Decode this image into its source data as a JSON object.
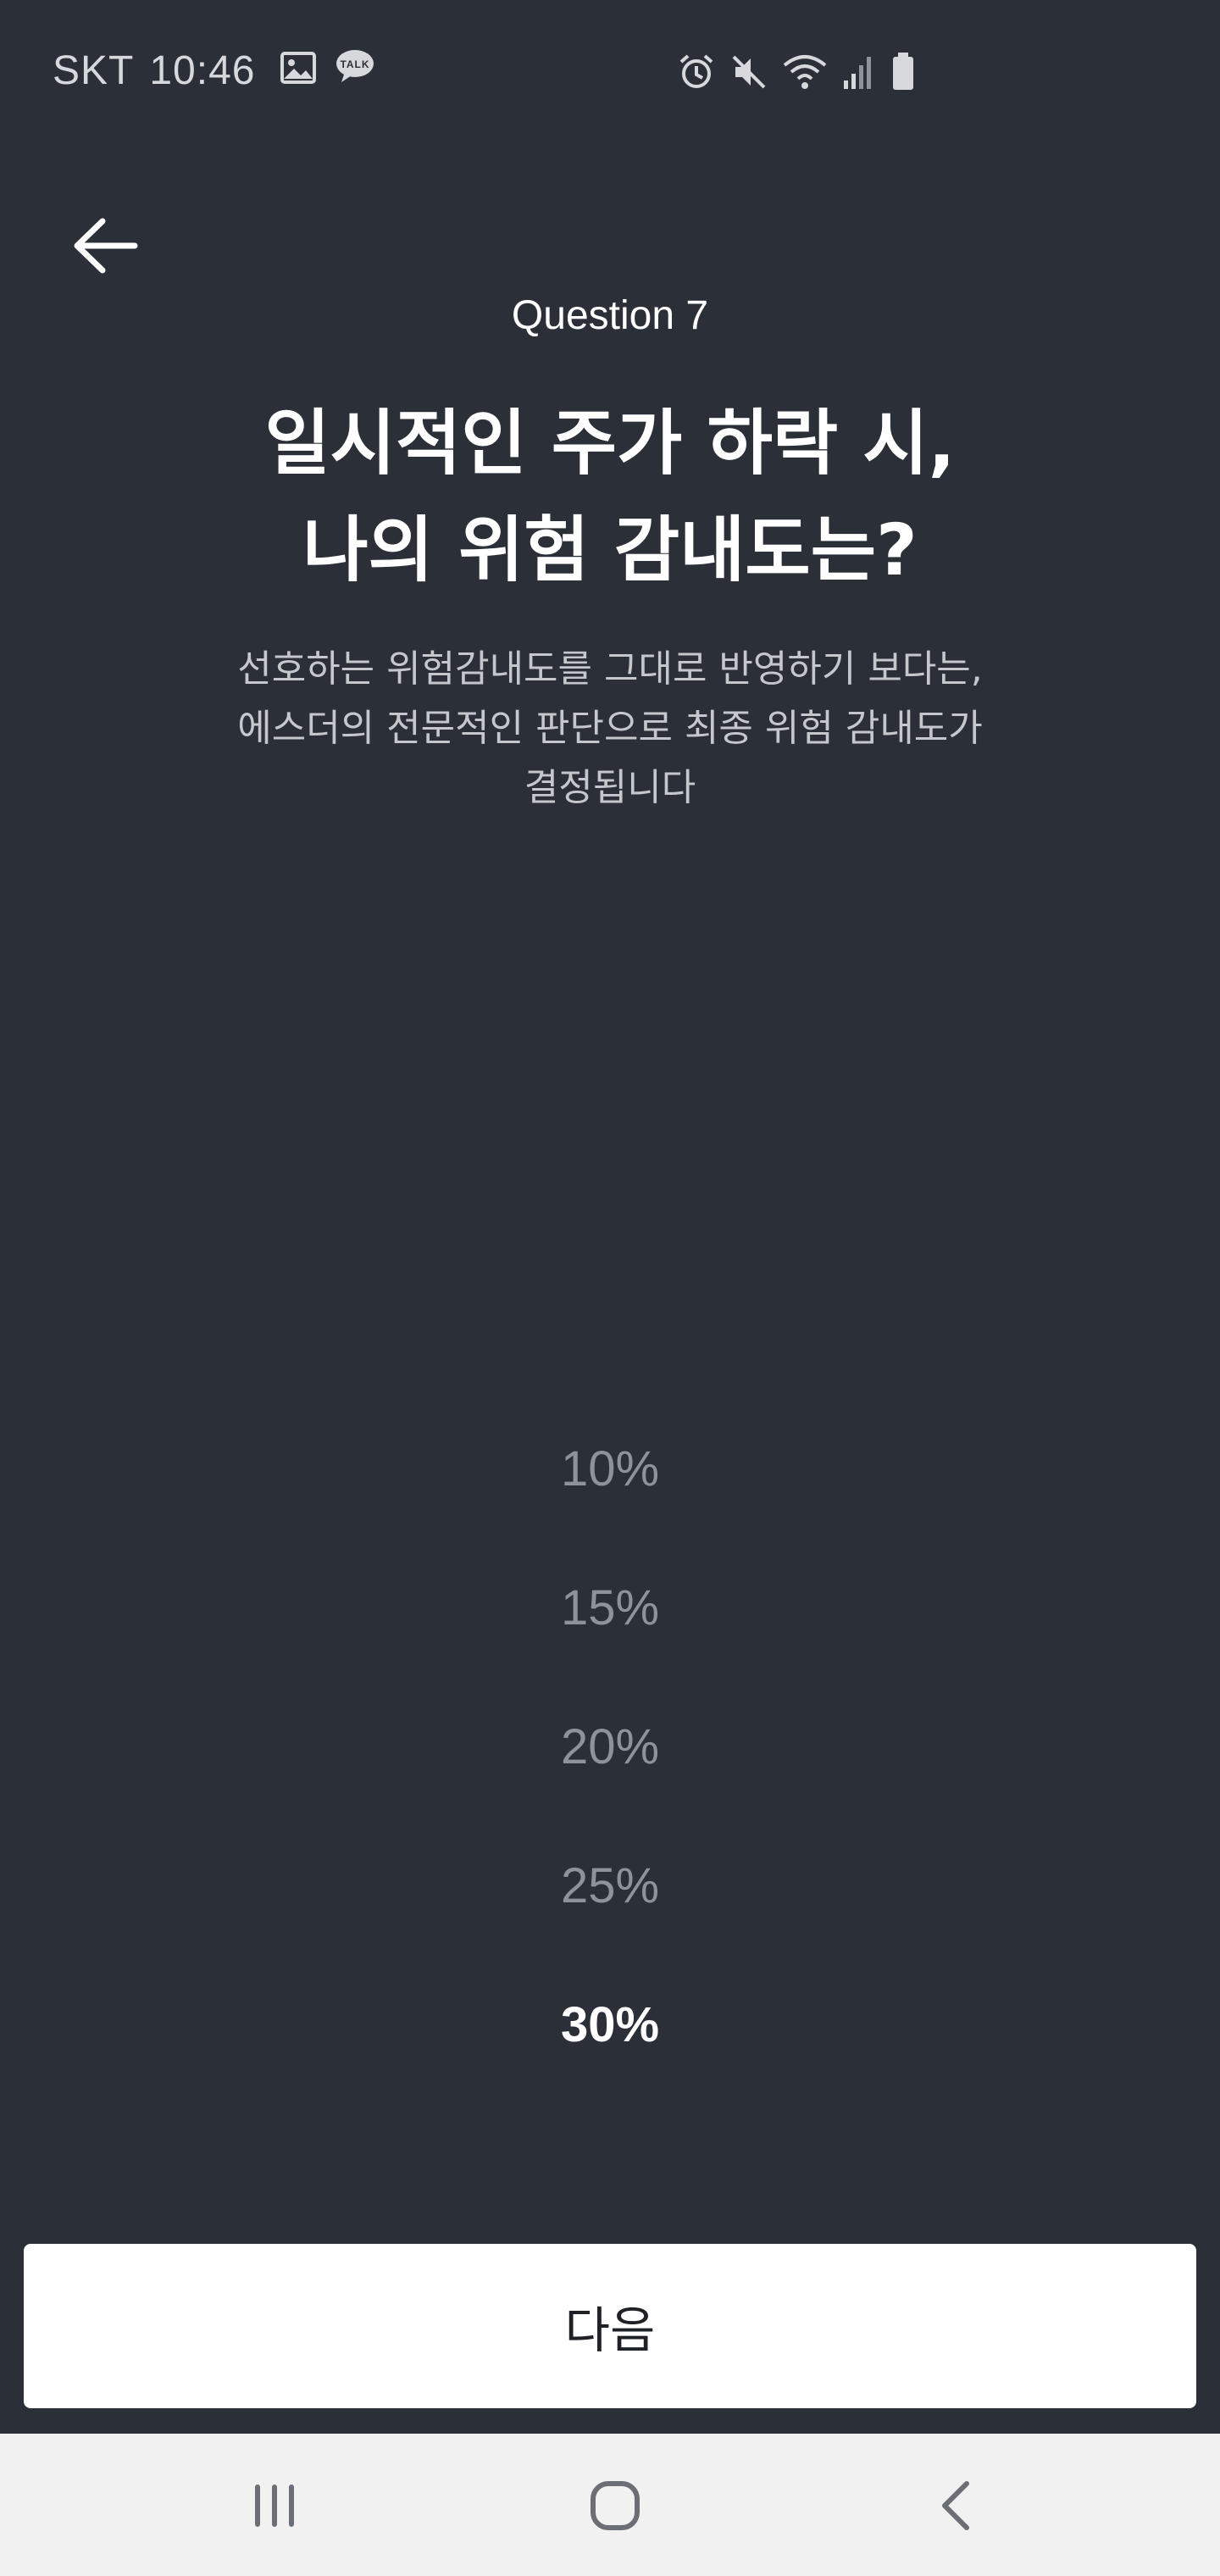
{
  "status_bar": {
    "carrier": "SKT",
    "time": "10:46",
    "icons": [
      "gallery-icon",
      "kakaotalk-icon",
      "alarm-icon",
      "mute-icon",
      "wifi-icon",
      "signal-icon",
      "battery-icon"
    ],
    "kakao_badge": "TALK"
  },
  "header": {
    "question_number": "Question 7",
    "title_line1": "일시적인 주가 하락 시,",
    "title_line2": "나의 위험 감내도는?",
    "desc_line1": "선호하는 위험감내도를 그대로 반영하기 보다는,",
    "desc_line2": "에스더의 전문적인 판단으로 최종 위험 감내도가",
    "desc_line3": "결정됩니다"
  },
  "picker": {
    "options": [
      "10%",
      "15%",
      "20%",
      "25%",
      "30%"
    ],
    "selected": "30%"
  },
  "footer": {
    "next_label": "다음"
  },
  "colors": {
    "background": "#2b3038",
    "text_primary": "#ffffff",
    "text_muted": "#8e939b",
    "button_bg": "#ffffff",
    "navbar_bg": "#f1f1f1"
  }
}
